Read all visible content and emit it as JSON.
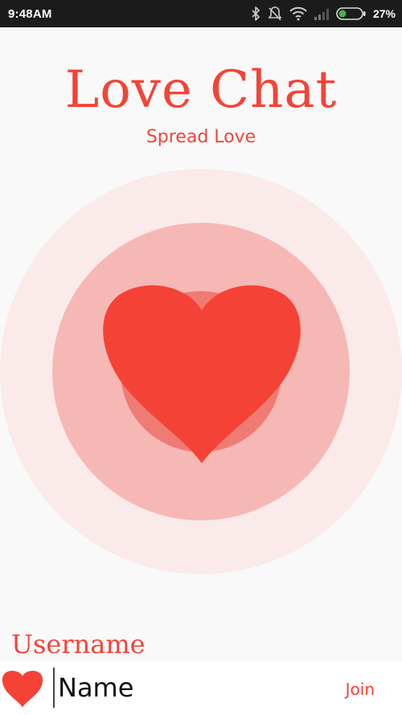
{
  "status_bar": {
    "time": "9:48AM",
    "battery_percent": "27%",
    "icons": [
      "bluetooth-icon",
      "silent-mode-icon",
      "wifi-icon",
      "signal-icon",
      "battery-icon"
    ]
  },
  "header": {
    "title": "Love Chat",
    "subtitle": "Spread Love"
  },
  "colors": {
    "accent": "#f44336",
    "outer_ring": "#fbeaea",
    "inner_ring": "#f6b8b5",
    "core_ring": "#f07a74"
  },
  "hero": {
    "icon": "heart-icon"
  },
  "form": {
    "label": "Username",
    "name_input_value": "Name",
    "join_label": "Join",
    "icon": "heart-icon"
  }
}
